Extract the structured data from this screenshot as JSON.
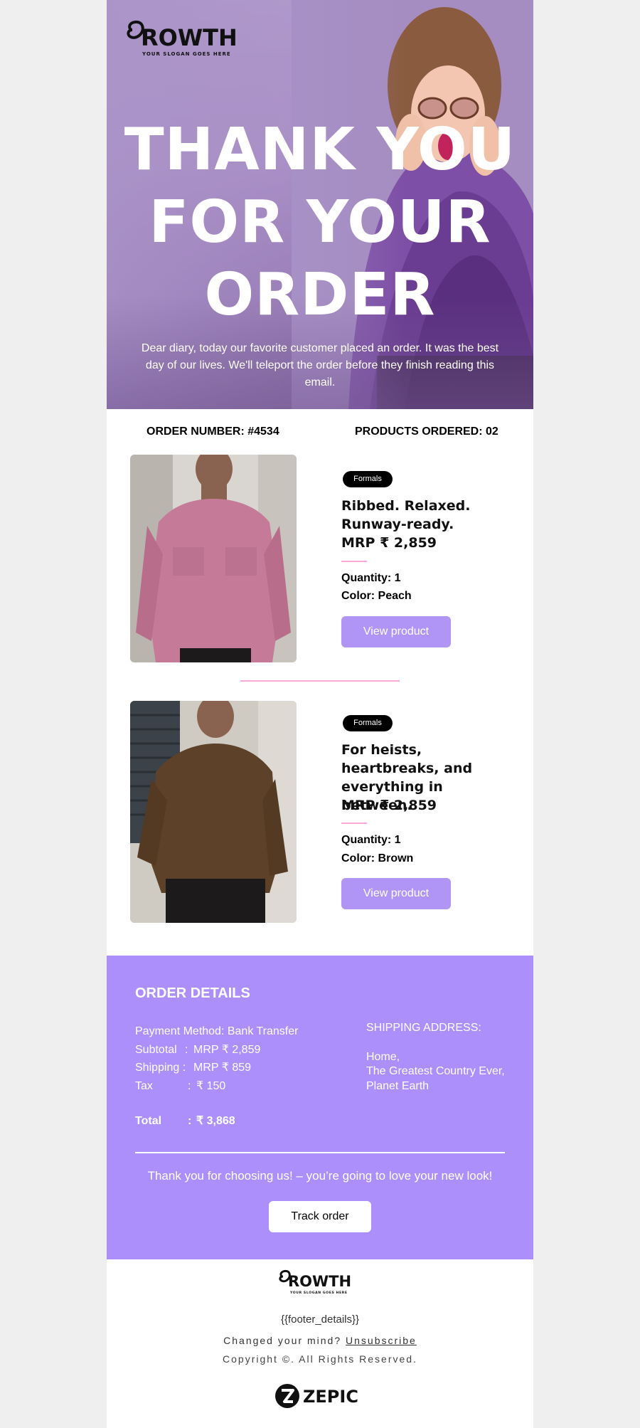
{
  "brand": {
    "name": "GROWTH",
    "slogan": "YOUR SLOGAN GOES HERE"
  },
  "hero": {
    "title_line1": "THANK YOU",
    "title_line2": "FOR YOUR",
    "title_line3": "ORDER",
    "text": "Dear diary, today our favorite customer placed an order. It was the best day of our lives. We'll teleport the order before they finish reading this email."
  },
  "order": {
    "number_label": "ORDER NUMBER: #4534",
    "products_label": "PRODUCTS ORDERED: 02"
  },
  "products": [
    {
      "badge": "Formals",
      "title": "Ribbed. Relaxed. Runway-ready.",
      "price": "MRP ₹ 2,859",
      "quantity": "Quantity: 1",
      "color": "Color: Peach",
      "button": "View product"
    },
    {
      "badge": "Formals",
      "title": "For heists, heartbreaks, and everything in between.",
      "price": "MRP ₹ 2,859",
      "quantity": "Quantity: 1",
      "color": "Color: Brown",
      "button": "View product"
    }
  ],
  "details": {
    "title": "ORDER DETAILS",
    "payment": "Payment Method: Bank Transfer",
    "subtotal_label": "Subtotal",
    "subtotal_value": "MRP ₹ 2,859",
    "shipping_label": "Shipping :",
    "shipping_value": "MRP ₹ 859",
    "tax_label": "Tax",
    "tax_value": "₹ 150",
    "total_label": "Total",
    "total_value": "₹ 3,868",
    "colon": ":",
    "shipping_address_title": "SHIPPING ADDRESS:",
    "address_line1": "Home,",
    "address_line2": "The Greatest Country Ever,",
    "address_line3": "Planet Earth",
    "thanks": "Thank you for choosing us! – you’re going to love your new look!",
    "track_button": "Track order"
  },
  "footer": {
    "details": "{{footer_details}}",
    "changed_mind": "Changed your mind? ",
    "unsubscribe": "Unsubscribe",
    "copyright": "Copyright ©. All Rights Reserved.",
    "powered_by": "ZEPIC"
  },
  "colors": {
    "accent": "#ac8ffb",
    "button": "#b095f7",
    "pink_divider": "#f7a8d8",
    "badge_bg": "#000000"
  }
}
